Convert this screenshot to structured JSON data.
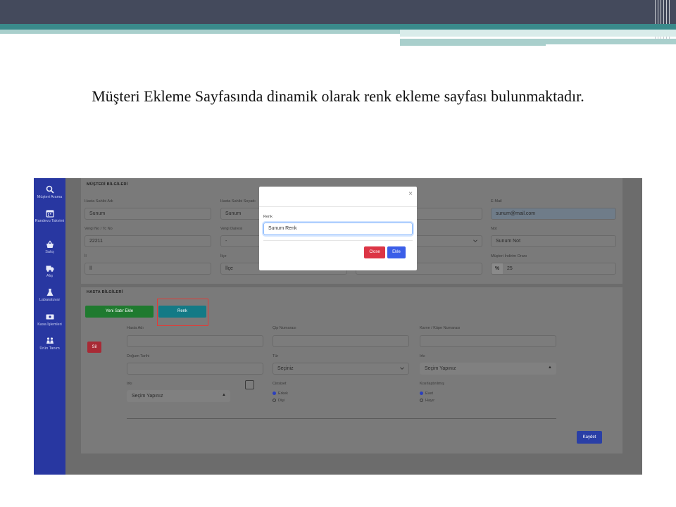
{
  "slide": {
    "heading": "Müşteri Ekleme Sayfasında dinamik olarak renk ekleme sayfası bulunmaktadır."
  },
  "sidebar": {
    "items": [
      {
        "icon": "search-icon",
        "label": "Müşteri Arama"
      },
      {
        "icon": "calendar-icon",
        "label": "Randevu Takvimi"
      },
      {
        "icon": "basket-icon",
        "label": "Satış"
      },
      {
        "icon": "truck-icon",
        "label": "Alış"
      },
      {
        "icon": "flask-icon",
        "label": "Labaratuvar"
      },
      {
        "icon": "cash-register-icon",
        "label": "Kasa İşlemleri"
      },
      {
        "icon": "people-icon",
        "label": "Ürün Tanım"
      }
    ]
  },
  "customer": {
    "title": "MÜŞTERİ BİLGİLERİ",
    "owner_name_label": "Hasta Sahibi Adı",
    "owner_name_value": "Sunum",
    "owner_surname_label": "Hasta Sahibi Soyadı",
    "owner_surname_value": "Sunum",
    "tax_no_label": "Vergi No / Tc No",
    "tax_no_value": "22211",
    "tax_office_label": "Vergi Dairesi",
    "tax_office_value": "-",
    "city_label": "İl",
    "city_value": "İl",
    "district_label": "İlçe",
    "district_value": "İlçe",
    "email_label": "E-Mail",
    "email_value": "sunum@mail.com",
    "note_label": "Not",
    "note_value": "Sunum Not",
    "discount_label": "Müşteri İndirim Oranı",
    "discount_symbol": "%",
    "discount_value": "25"
  },
  "patient": {
    "title": "HASTA BİLGİLERİ",
    "new_row_button": "Yeni Satır Ekle",
    "color_button": "Renk",
    "delete_button": "Sil",
    "name_label": "Hasta Adı",
    "chip_label": "Çip Numarası",
    "ear_tag_label": "Karne / Küpe Numarası",
    "birth_label": "Doğum Tarihi",
    "species_label": "Tür",
    "species_value": "Seçiniz",
    "breed_label": "Irkı",
    "breed_value": "Seçim Yapınız",
    "color_label": "Irkı",
    "color_value": "Seçim Yapınız",
    "gender_label": "Cinsiyet",
    "gender_options": [
      "Erkek",
      "Dişi"
    ],
    "neutered_label": "Kısırlaştırılmış",
    "neutered_options": [
      "Evet",
      "Hayır"
    ],
    "save_button": "Kaydet"
  },
  "modal": {
    "close_glyph": "×",
    "field_label": "Renk",
    "field_value": "Sunum Renk",
    "close_button": "Close",
    "add_button": "Ekle"
  },
  "colors": {
    "sidebar": "#2837a1",
    "green_button": "#1f7a2f",
    "teal_button": "#137a86",
    "danger": "#dc3545",
    "primary": "#3b5ee8",
    "annotation": "#e53935"
  }
}
